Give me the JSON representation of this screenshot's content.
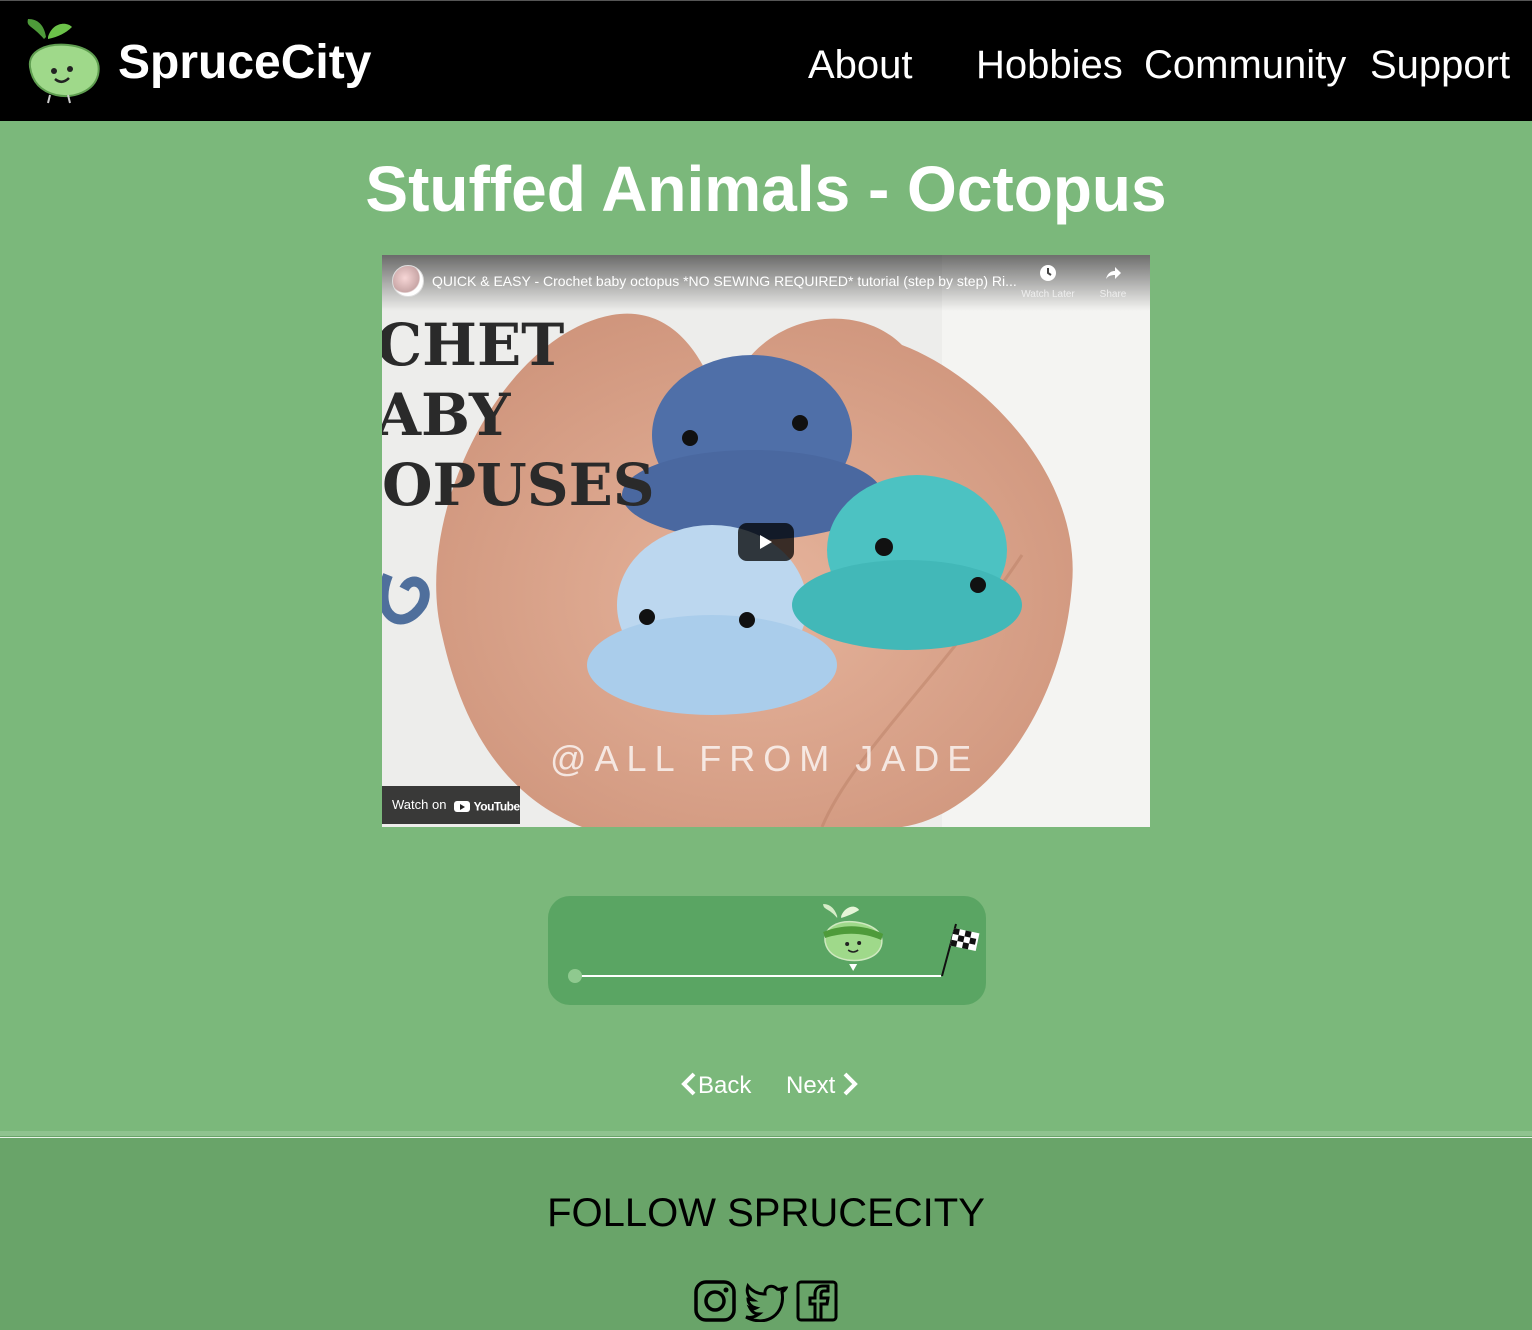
{
  "header": {
    "brand": "SpruceCity",
    "nav": [
      "About",
      "Hobbies",
      "Community",
      "Support"
    ]
  },
  "page": {
    "title": "Stuffed Animals - Octopus"
  },
  "video": {
    "title": "QUICK & EASY - Crochet baby octopus *NO SEWING REQUIRED* tutorial (step by step) Ri...",
    "watch_later_label": "Watch Later",
    "share_label": "Share",
    "watch_on_label": "Watch on",
    "youtube_label": "YouTube",
    "overlay_text_lines": [
      "CHET",
      "ABY",
      "OPUSES"
    ],
    "watermark": "@ALL FROM JADE"
  },
  "progress": {
    "fraction": 0.76,
    "icons": [
      "spruce-mascot-icon",
      "checkered-flag-icon"
    ]
  },
  "pager": {
    "back_label": "Back",
    "next_label": "Next"
  },
  "footer": {
    "follow_heading": "FOLLOW SPRUCECITY",
    "social_icons": [
      "instagram-icon",
      "twitter-icon",
      "facebook-icon"
    ]
  },
  "colors": {
    "page_bg": "#7bb87b",
    "header_bg": "#000000",
    "progress_card_bg": "#5aa563",
    "footer_bg": "#69a469",
    "mascot_green": "#9fd98a"
  }
}
